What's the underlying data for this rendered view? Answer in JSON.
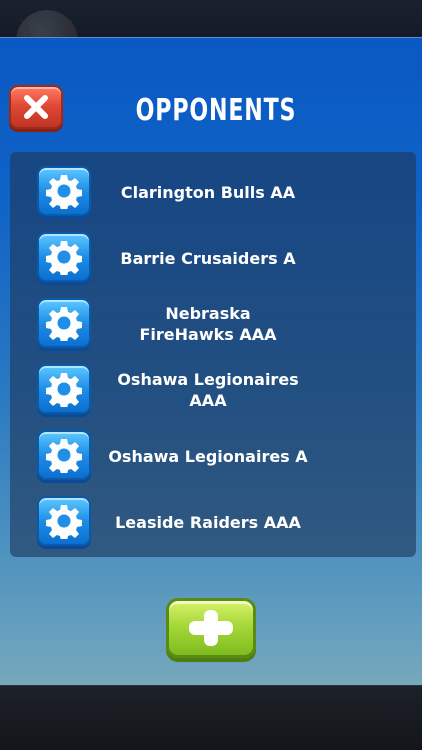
{
  "modal": {
    "title": "OPPONENTS"
  },
  "icons": {
    "close": "close-x-icon",
    "settings": "gear-icon",
    "add": "plus-icon"
  },
  "teams": [
    {
      "name": "Clarington Bulls AA"
    },
    {
      "name": "Barrie Crusaiders A"
    },
    {
      "name": "Nebraska FireHawks AAA"
    },
    {
      "name": "Oshawa Legionaires AAA"
    },
    {
      "name": "Oshawa Legionaires A"
    },
    {
      "name": "Leaside Raiders AAA"
    }
  ],
  "colors": {
    "modal_top": "#0a58c4",
    "close_button": "#e24a36",
    "settings_button": "#1e8ee8",
    "add_button": "#a6d83a"
  }
}
